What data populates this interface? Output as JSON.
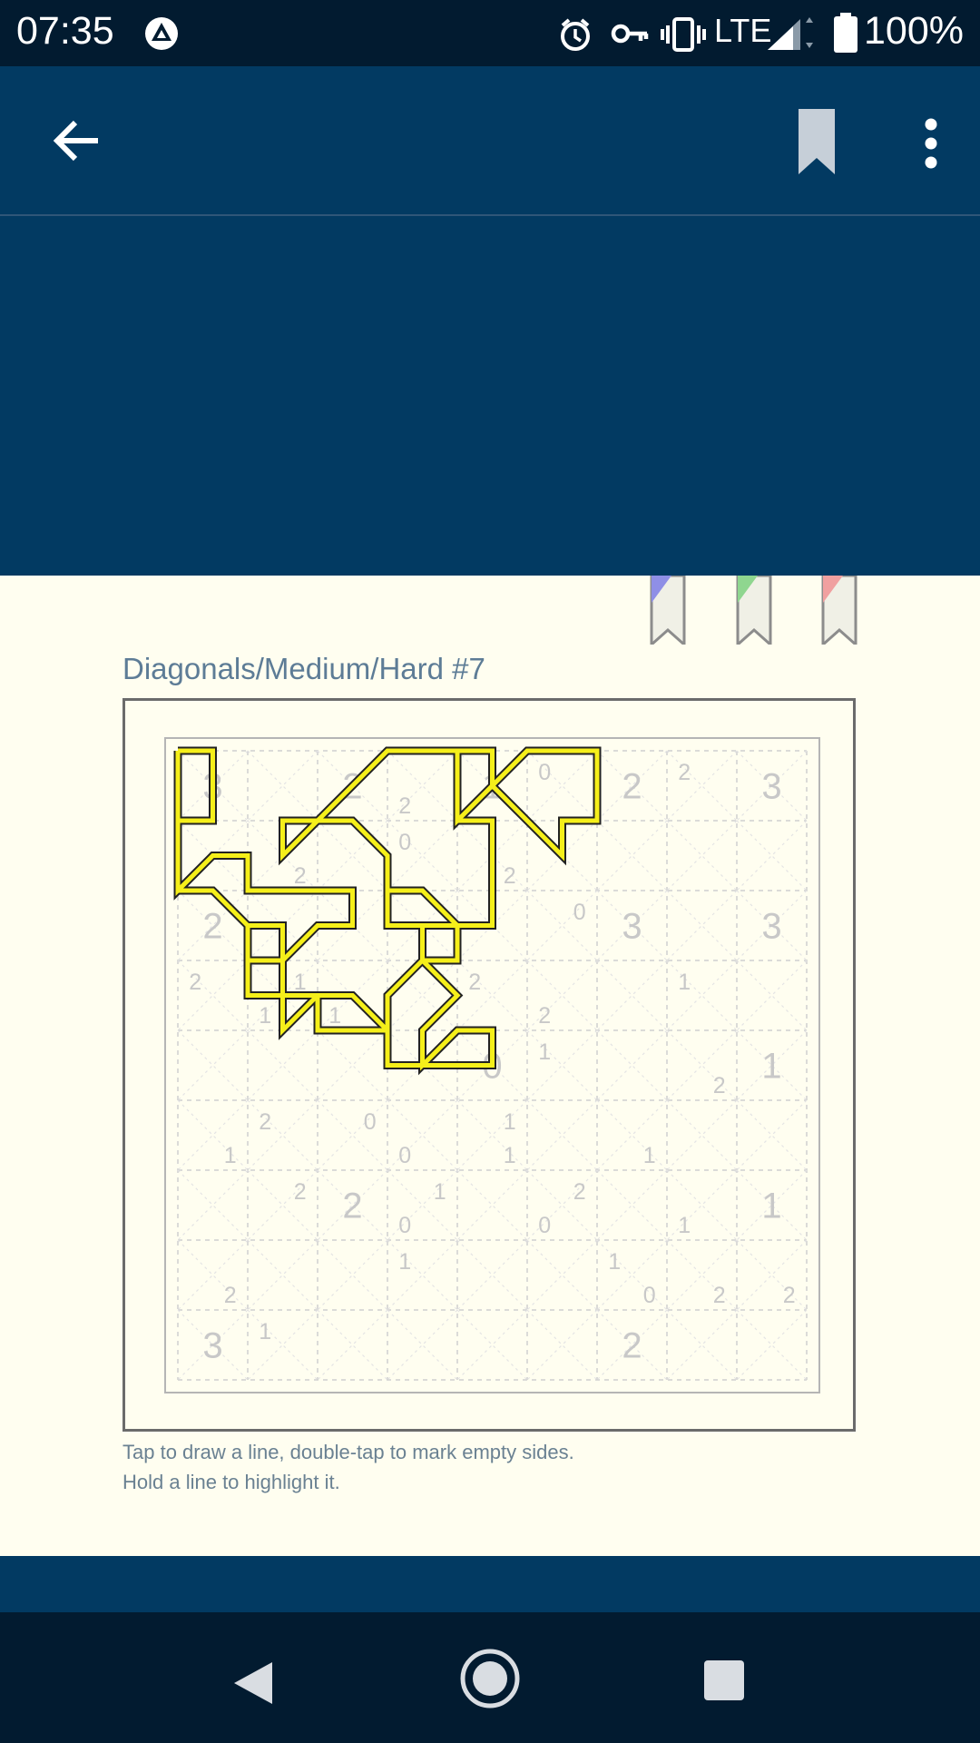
{
  "status_bar": {
    "time": "07:35",
    "network": "LTE",
    "battery": "100%",
    "icons": [
      "app-notification-icon",
      "alarm-icon",
      "vpn-key-icon",
      "vibrate-icon",
      "signal-icon",
      "battery-icon"
    ]
  },
  "app_bar": {
    "icons": [
      "back-arrow-icon",
      "bookmark-icon",
      "more-vert-icon"
    ]
  },
  "puzzle": {
    "title": "Diagonals/Medium/Hard #7",
    "ribbon_colors": [
      "#8f8fe6",
      "#8fd68f",
      "#f0a0a0"
    ],
    "line_color": "#f5ef1a",
    "big_clues": [
      {
        "r": 0,
        "c": 0,
        "v": "3"
      },
      {
        "r": 0,
        "c": 2,
        "v": "2"
      },
      {
        "r": 0,
        "c": 4,
        "v": "1"
      },
      {
        "r": 0,
        "c": 6,
        "v": "2"
      },
      {
        "r": 0,
        "c": 8,
        "v": "3"
      },
      {
        "r": 2,
        "c": 0,
        "v": "2"
      },
      {
        "r": 2,
        "c": 6,
        "v": "3"
      },
      {
        "r": 2,
        "c": 8,
        "v": "3"
      },
      {
        "r": 4,
        "c": 4,
        "v": "0"
      },
      {
        "r": 4,
        "c": 8,
        "v": "1"
      },
      {
        "r": 6,
        "c": 2,
        "v": "2"
      },
      {
        "r": 6,
        "c": 8,
        "v": "1"
      },
      {
        "r": 8,
        "c": 0,
        "v": "3"
      },
      {
        "r": 8,
        "c": 6,
        "v": "2"
      }
    ],
    "small_clues": [
      {
        "r": 0,
        "c": 5,
        "p": "tl",
        "v": "0"
      },
      {
        "r": 0,
        "c": 7,
        "p": "tl",
        "v": "2"
      },
      {
        "r": 0,
        "c": 3,
        "p": "bl",
        "v": "2"
      },
      {
        "r": 1,
        "c": 1,
        "p": "br",
        "v": "2"
      },
      {
        "r": 1,
        "c": 3,
        "p": "tl",
        "v": "0"
      },
      {
        "r": 1,
        "c": 4,
        "p": "br",
        "v": "2"
      },
      {
        "r": 2,
        "c": 5,
        "p": "tr",
        "v": "0"
      },
      {
        "r": 3,
        "c": 0,
        "p": "tl",
        "v": "2"
      },
      {
        "r": 3,
        "c": 1,
        "p": "tr",
        "v": "1"
      },
      {
        "r": 3,
        "c": 1,
        "p": "bl",
        "v": "1"
      },
      {
        "r": 3,
        "c": 2,
        "p": "bl",
        "v": "1"
      },
      {
        "r": 3,
        "c": 4,
        "p": "tl",
        "v": "2"
      },
      {
        "r": 3,
        "c": 5,
        "p": "bl",
        "v": "2"
      },
      {
        "r": 3,
        "c": 7,
        "p": "tl",
        "v": "1"
      },
      {
        "r": 4,
        "c": 5,
        "p": "tl",
        "v": "1"
      },
      {
        "r": 4,
        "c": 7,
        "p": "br",
        "v": "2"
      },
      {
        "r": 5,
        "c": 1,
        "p": "tl",
        "v": "2"
      },
      {
        "r": 5,
        "c": 0,
        "p": "br",
        "v": "1"
      },
      {
        "r": 5,
        "c": 2,
        "p": "tr",
        "v": "0"
      },
      {
        "r": 5,
        "c": 3,
        "p": "bl",
        "v": "0"
      },
      {
        "r": 5,
        "c": 4,
        "p": "tr",
        "v": "1"
      },
      {
        "r": 5,
        "c": 4,
        "p": "br",
        "v": "1"
      },
      {
        "r": 5,
        "c": 6,
        "p": "br",
        "v": "1"
      },
      {
        "r": 6,
        "c": 1,
        "p": "tr",
        "v": "2"
      },
      {
        "r": 6,
        "c": 3,
        "p": "tr",
        "v": "1"
      },
      {
        "r": 6,
        "c": 3,
        "p": "bl",
        "v": "0"
      },
      {
        "r": 6,
        "c": 5,
        "p": "tr",
        "v": "2"
      },
      {
        "r": 6,
        "c": 5,
        "p": "bl",
        "v": "0"
      },
      {
        "r": 6,
        "c": 7,
        "p": "bl",
        "v": "1"
      },
      {
        "r": 7,
        "c": 3,
        "p": "tl",
        "v": "1"
      },
      {
        "r": 7,
        "c": 6,
        "p": "tl",
        "v": "1"
      },
      {
        "r": 7,
        "c": 6,
        "p": "br",
        "v": "0"
      },
      {
        "r": 7,
        "c": 0,
        "p": "br",
        "v": "2"
      },
      {
        "r": 7,
        "c": 7,
        "p": "br",
        "v": "2"
      },
      {
        "r": 7,
        "c": 8,
        "p": "br",
        "v": "2"
      },
      {
        "r": 8,
        "c": 1,
        "p": "tl",
        "v": "1"
      }
    ],
    "loop": [
      [
        0,
        0
      ],
      [
        1,
        0
      ],
      [
        1,
        2
      ],
      [
        0,
        2
      ],
      [
        0,
        4
      ],
      [
        1,
        3
      ],
      [
        2,
        3
      ],
      [
        2,
        4
      ],
      [
        5,
        4
      ],
      [
        5,
        5
      ],
      [
        4,
        5
      ],
      [
        3,
        6
      ],
      [
        3,
        5
      ],
      [
        2,
        5
      ],
      [
        2,
        7
      ],
      [
        3,
        7
      ],
      [
        3,
        8
      ],
      [
        4,
        7
      ],
      [
        5,
        7
      ],
      [
        6,
        8
      ],
      [
        6,
        9
      ],
      [
        7,
        9
      ],
      [
        8,
        9
      ],
      [
        9,
        9
      ],
      [
        9,
        8
      ],
      [
        8,
        8
      ],
      [
        7,
        9
      ],
      [
        7,
        8
      ],
      [
        8,
        7
      ],
      [
        7,
        6
      ],
      [
        7,
        5
      ],
      [
        6,
        5
      ],
      [
        6,
        4
      ],
      [
        7,
        4
      ],
      [
        8,
        5
      ],
      [
        9,
        5
      ],
      [
        9,
        4
      ],
      [
        9,
        2
      ],
      [
        8,
        2
      ],
      [
        8,
        1
      ],
      [
        8,
        0
      ],
      [
        9,
        0
      ],
      [
        9,
        1
      ],
      [
        10,
        2
      ],
      [
        11,
        3
      ],
      [
        11,
        2
      ],
      [
        12,
        2
      ],
      [
        12,
        0
      ],
      [
        11,
        0
      ],
      [
        10,
        0
      ],
      [
        9,
        1
      ],
      [
        8,
        2
      ],
      [
        8,
        0
      ],
      [
        7,
        0
      ],
      [
        6,
        0
      ],
      [
        5,
        1
      ],
      [
        4,
        2
      ],
      [
        3,
        2
      ],
      [
        3,
        3
      ],
      [
        4,
        2
      ],
      [
        5,
        2
      ],
      [
        6,
        3
      ],
      [
        6,
        5
      ],
      [
        7,
        5
      ],
      [
        8,
        5
      ],
      [
        8,
        6
      ],
      [
        7,
        6
      ],
      [
        6,
        7
      ],
      [
        6,
        8
      ],
      [
        5,
        8
      ],
      [
        4,
        8
      ],
      [
        4,
        7
      ],
      [
        3,
        7
      ],
      [
        3,
        6
      ],
      [
        2,
        6
      ],
      [
        2,
        5
      ],
      [
        1,
        4
      ],
      [
        0,
        4
      ],
      [
        0,
        2
      ],
      [
        0,
        0
      ]
    ],
    "instructions": [
      "Tap to draw a line, double-tap to mark empty sides.",
      "Hold a line to highlight it."
    ]
  },
  "navigation": {
    "icons": [
      "nav-back-icon",
      "nav-home-icon",
      "nav-recents-icon"
    ]
  }
}
